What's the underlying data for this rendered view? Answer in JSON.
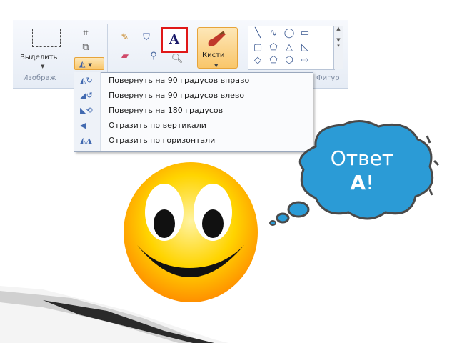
{
  "ribbon": {
    "select_label": "Выделить",
    "image_group_caption": "Изображ",
    "shapes_group_caption": "Фигур",
    "text_tool_label": "A",
    "brushes_label": "Кисти"
  },
  "rotate_menu": {
    "items": [
      {
        "label": "Повернуть на 90 градусов вправо",
        "icon": "rotate-right-icon"
      },
      {
        "label": "Повернуть на 90 градусов влево",
        "icon": "rotate-left-icon"
      },
      {
        "label": "Повернуть на 180 градусов",
        "icon": "rotate-180-icon"
      },
      {
        "label": "Отразить по вертикали",
        "icon": "flip-vertical-icon"
      },
      {
        "label": "Отразить по горизонтали",
        "icon": "flip-horizontal-icon"
      }
    ]
  },
  "bubble": {
    "word": "Ответ",
    "letter": "А",
    "punct": "!"
  },
  "colors": {
    "highlight": "#e01818",
    "bubble_fill": "#2b9bd6",
    "smiley_fill": "#ffd400"
  }
}
